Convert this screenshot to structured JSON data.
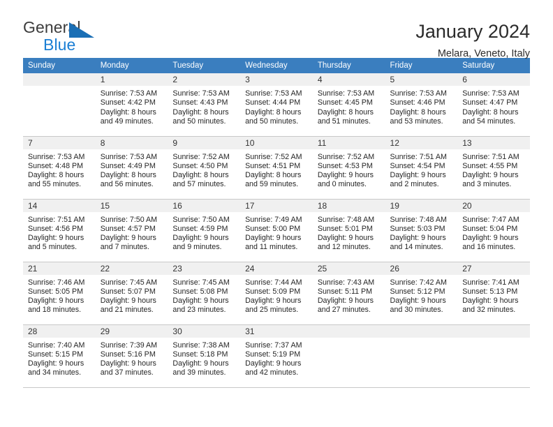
{
  "logo": {
    "word_top": "General",
    "word_bottom": "Blue",
    "triangle_icon": "triangle-icon",
    "accent_color": "#1b7fd4"
  },
  "header": {
    "title": "January 2024",
    "subtitle": "Melara, Veneto, Italy"
  },
  "calendar": {
    "header_color": "#3a7ebf",
    "weekday_headers": [
      "Sunday",
      "Monday",
      "Tuesday",
      "Wednesday",
      "Thursday",
      "Friday",
      "Saturday"
    ],
    "weeks": [
      [
        {
          "day": "",
          "sunrise": "",
          "sunset": "",
          "daylight1": "",
          "daylight2": "",
          "empty": true
        },
        {
          "day": "1",
          "sunrise": "Sunrise: 7:53 AM",
          "sunset": "Sunset: 4:42 PM",
          "daylight1": "Daylight: 8 hours",
          "daylight2": "and 49 minutes."
        },
        {
          "day": "2",
          "sunrise": "Sunrise: 7:53 AM",
          "sunset": "Sunset: 4:43 PM",
          "daylight1": "Daylight: 8 hours",
          "daylight2": "and 50 minutes."
        },
        {
          "day": "3",
          "sunrise": "Sunrise: 7:53 AM",
          "sunset": "Sunset: 4:44 PM",
          "daylight1": "Daylight: 8 hours",
          "daylight2": "and 50 minutes."
        },
        {
          "day": "4",
          "sunrise": "Sunrise: 7:53 AM",
          "sunset": "Sunset: 4:45 PM",
          "daylight1": "Daylight: 8 hours",
          "daylight2": "and 51 minutes."
        },
        {
          "day": "5",
          "sunrise": "Sunrise: 7:53 AM",
          "sunset": "Sunset: 4:46 PM",
          "daylight1": "Daylight: 8 hours",
          "daylight2": "and 53 minutes."
        },
        {
          "day": "6",
          "sunrise": "Sunrise: 7:53 AM",
          "sunset": "Sunset: 4:47 PM",
          "daylight1": "Daylight: 8 hours",
          "daylight2": "and 54 minutes."
        }
      ],
      [
        {
          "day": "7",
          "sunrise": "Sunrise: 7:53 AM",
          "sunset": "Sunset: 4:48 PM",
          "daylight1": "Daylight: 8 hours",
          "daylight2": "and 55 minutes."
        },
        {
          "day": "8",
          "sunrise": "Sunrise: 7:53 AM",
          "sunset": "Sunset: 4:49 PM",
          "daylight1": "Daylight: 8 hours",
          "daylight2": "and 56 minutes."
        },
        {
          "day": "9",
          "sunrise": "Sunrise: 7:52 AM",
          "sunset": "Sunset: 4:50 PM",
          "daylight1": "Daylight: 8 hours",
          "daylight2": "and 57 minutes."
        },
        {
          "day": "10",
          "sunrise": "Sunrise: 7:52 AM",
          "sunset": "Sunset: 4:51 PM",
          "daylight1": "Daylight: 8 hours",
          "daylight2": "and 59 minutes."
        },
        {
          "day": "11",
          "sunrise": "Sunrise: 7:52 AM",
          "sunset": "Sunset: 4:53 PM",
          "daylight1": "Daylight: 9 hours",
          "daylight2": "and 0 minutes."
        },
        {
          "day": "12",
          "sunrise": "Sunrise: 7:51 AM",
          "sunset": "Sunset: 4:54 PM",
          "daylight1": "Daylight: 9 hours",
          "daylight2": "and 2 minutes."
        },
        {
          "day": "13",
          "sunrise": "Sunrise: 7:51 AM",
          "sunset": "Sunset: 4:55 PM",
          "daylight1": "Daylight: 9 hours",
          "daylight2": "and 3 minutes."
        }
      ],
      [
        {
          "day": "14",
          "sunrise": "Sunrise: 7:51 AM",
          "sunset": "Sunset: 4:56 PM",
          "daylight1": "Daylight: 9 hours",
          "daylight2": "and 5 minutes."
        },
        {
          "day": "15",
          "sunrise": "Sunrise: 7:50 AM",
          "sunset": "Sunset: 4:57 PM",
          "daylight1": "Daylight: 9 hours",
          "daylight2": "and 7 minutes."
        },
        {
          "day": "16",
          "sunrise": "Sunrise: 7:50 AM",
          "sunset": "Sunset: 4:59 PM",
          "daylight1": "Daylight: 9 hours",
          "daylight2": "and 9 minutes."
        },
        {
          "day": "17",
          "sunrise": "Sunrise: 7:49 AM",
          "sunset": "Sunset: 5:00 PM",
          "daylight1": "Daylight: 9 hours",
          "daylight2": "and 11 minutes."
        },
        {
          "day": "18",
          "sunrise": "Sunrise: 7:48 AM",
          "sunset": "Sunset: 5:01 PM",
          "daylight1": "Daylight: 9 hours",
          "daylight2": "and 12 minutes."
        },
        {
          "day": "19",
          "sunrise": "Sunrise: 7:48 AM",
          "sunset": "Sunset: 5:03 PM",
          "daylight1": "Daylight: 9 hours",
          "daylight2": "and 14 minutes."
        },
        {
          "day": "20",
          "sunrise": "Sunrise: 7:47 AM",
          "sunset": "Sunset: 5:04 PM",
          "daylight1": "Daylight: 9 hours",
          "daylight2": "and 16 minutes."
        }
      ],
      [
        {
          "day": "21",
          "sunrise": "Sunrise: 7:46 AM",
          "sunset": "Sunset: 5:05 PM",
          "daylight1": "Daylight: 9 hours",
          "daylight2": "and 18 minutes."
        },
        {
          "day": "22",
          "sunrise": "Sunrise: 7:45 AM",
          "sunset": "Sunset: 5:07 PM",
          "daylight1": "Daylight: 9 hours",
          "daylight2": "and 21 minutes."
        },
        {
          "day": "23",
          "sunrise": "Sunrise: 7:45 AM",
          "sunset": "Sunset: 5:08 PM",
          "daylight1": "Daylight: 9 hours",
          "daylight2": "and 23 minutes."
        },
        {
          "day": "24",
          "sunrise": "Sunrise: 7:44 AM",
          "sunset": "Sunset: 5:09 PM",
          "daylight1": "Daylight: 9 hours",
          "daylight2": "and 25 minutes."
        },
        {
          "day": "25",
          "sunrise": "Sunrise: 7:43 AM",
          "sunset": "Sunset: 5:11 PM",
          "daylight1": "Daylight: 9 hours",
          "daylight2": "and 27 minutes."
        },
        {
          "day": "26",
          "sunrise": "Sunrise: 7:42 AM",
          "sunset": "Sunset: 5:12 PM",
          "daylight1": "Daylight: 9 hours",
          "daylight2": "and 30 minutes."
        },
        {
          "day": "27",
          "sunrise": "Sunrise: 7:41 AM",
          "sunset": "Sunset: 5:13 PM",
          "daylight1": "Daylight: 9 hours",
          "daylight2": "and 32 minutes."
        }
      ],
      [
        {
          "day": "28",
          "sunrise": "Sunrise: 7:40 AM",
          "sunset": "Sunset: 5:15 PM",
          "daylight1": "Daylight: 9 hours",
          "daylight2": "and 34 minutes."
        },
        {
          "day": "29",
          "sunrise": "Sunrise: 7:39 AM",
          "sunset": "Sunset: 5:16 PM",
          "daylight1": "Daylight: 9 hours",
          "daylight2": "and 37 minutes."
        },
        {
          "day": "30",
          "sunrise": "Sunrise: 7:38 AM",
          "sunset": "Sunset: 5:18 PM",
          "daylight1": "Daylight: 9 hours",
          "daylight2": "and 39 minutes."
        },
        {
          "day": "31",
          "sunrise": "Sunrise: 7:37 AM",
          "sunset": "Sunset: 5:19 PM",
          "daylight1": "Daylight: 9 hours",
          "daylight2": "and 42 minutes."
        },
        {
          "day": "",
          "sunrise": "",
          "sunset": "",
          "daylight1": "",
          "daylight2": "",
          "empty": true
        },
        {
          "day": "",
          "sunrise": "",
          "sunset": "",
          "daylight1": "",
          "daylight2": "",
          "empty": true
        },
        {
          "day": "",
          "sunrise": "",
          "sunset": "",
          "daylight1": "",
          "daylight2": "",
          "empty": true
        }
      ]
    ]
  }
}
